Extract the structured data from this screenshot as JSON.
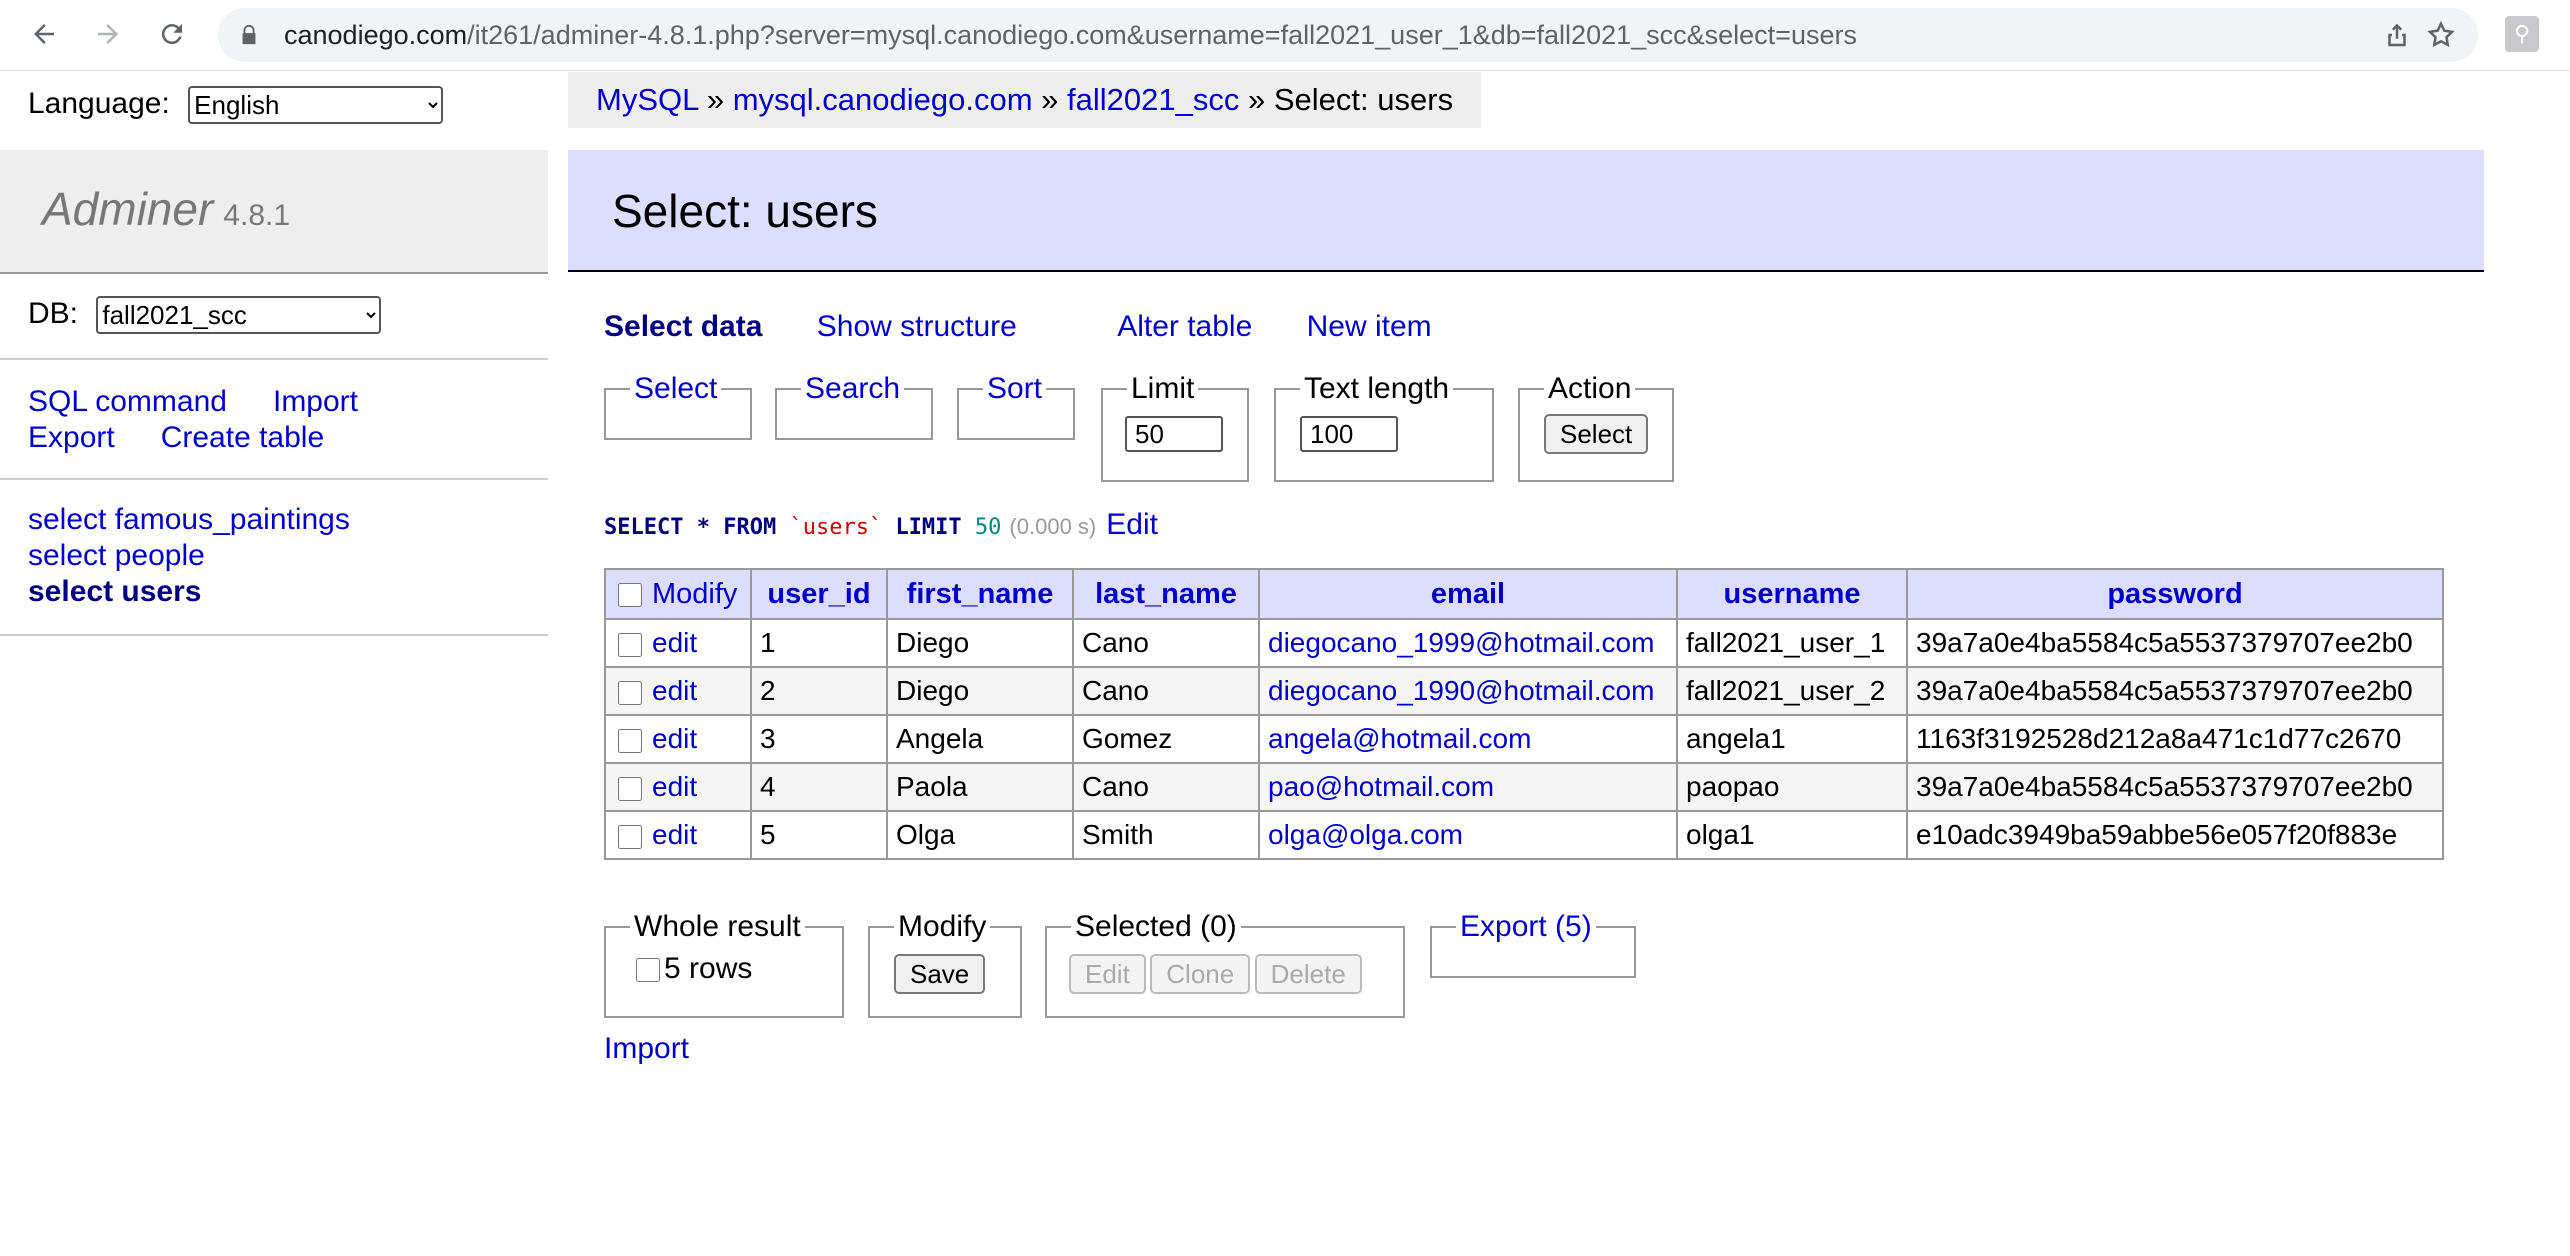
{
  "browser": {
    "url_host": "canodiego.com",
    "url_path": "/it261/adminer-4.8.1.php?server=mysql.canodiego.com&username=fall2021_user_1&db=fall2021_scc&select=users"
  },
  "sidebar": {
    "language_label": "Language:",
    "language_value": "English",
    "brand": "Adminer",
    "version": "4.8.1",
    "db_label": "DB:",
    "db_value": "fall2021_scc",
    "links": [
      "SQL command",
      "Import",
      "Export",
      "Create table"
    ],
    "tables": [
      {
        "prefix": "select",
        "name": "famous_paintings",
        "current": false
      },
      {
        "prefix": "select",
        "name": "people",
        "current": false
      },
      {
        "prefix": "select",
        "name": "users",
        "current": true
      }
    ]
  },
  "breadcrumb": {
    "items": [
      "MySQL",
      "mysql.canodiego.com",
      "fall2021_scc"
    ],
    "separator": "»",
    "current": "Select: users"
  },
  "page_title": "Select: users",
  "tabs": [
    "Select data",
    "Show structure",
    "Alter table",
    "New item"
  ],
  "form": {
    "select_legend": "Select",
    "search_legend": "Search",
    "sort_legend": "Sort",
    "limit_legend": "Limit",
    "limit_value": "50",
    "textlen_legend": "Text length",
    "textlen_value": "100",
    "action_legend": "Action",
    "action_button": "Select"
  },
  "query": {
    "kw_select": "SELECT",
    "star": "*",
    "kw_from": "FROM",
    "table": "`users`",
    "kw_limit": "LIMIT",
    "limit": "50",
    "time": "(0.000 s)",
    "edit_link": "Edit"
  },
  "table": {
    "modify_header": "Modify",
    "columns": [
      "user_id",
      "first_name",
      "last_name",
      "email",
      "username",
      "password"
    ],
    "edit_label": "edit",
    "rows": [
      [
        "1",
        "Diego",
        "Cano",
        "diegocano_1999@hotmail.com",
        "fall2021_user_1",
        "39a7a0e4ba5584c5a5537379707ee2b0"
      ],
      [
        "2",
        "Diego",
        "Cano",
        "diegocano_1990@hotmail.com",
        "fall2021_user_2",
        "39a7a0e4ba5584c5a5537379707ee2b0"
      ],
      [
        "3",
        "Angela",
        "Gomez",
        "angela@hotmail.com",
        "angela1",
        "1163f3192528d212a8a471c1d77c2670"
      ],
      [
        "4",
        "Paola",
        "Cano",
        "pao@hotmail.com",
        "paopao",
        "39a7a0e4ba5584c5a5537379707ee2b0"
      ],
      [
        "5",
        "Olga",
        "Smith",
        "olga@olga.com",
        "olga1",
        "e10adc3949ba59abbe56e057f20f883e"
      ]
    ]
  },
  "bottom": {
    "whole_result_legend": "Whole result",
    "whole_result_rows": "5 rows",
    "modify_legend": "Modify",
    "save_button": "Save",
    "selected_legend": "Selected (0)",
    "edit_button": "Edit",
    "clone_button": "Clone",
    "delete_button": "Delete",
    "export_legend": "Export (5)",
    "import_link": "Import"
  }
}
